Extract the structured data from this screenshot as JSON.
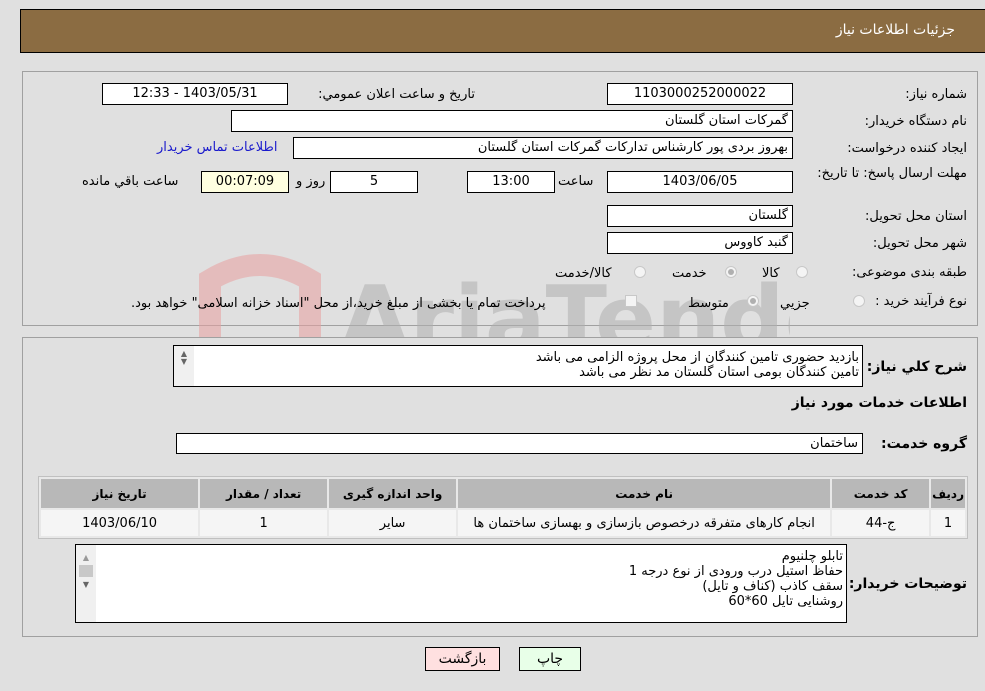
{
  "header": {
    "title": "جزئیات اطلاعات نیاز"
  },
  "details": {
    "need_number": {
      "label": "شماره نیاز:",
      "value": "1103000252000022"
    },
    "announce_datetime": {
      "label": "تاریخ و ساعت اعلان عمومي:",
      "value": "1403/05/31 - 12:33"
    },
    "buyer_org": {
      "label": "نام دستگاه خریدار:",
      "value": "گمرکات استان گلستان"
    },
    "requester": {
      "label": "ایجاد کننده درخواست:",
      "value": "بهروز بردی پور کارشناس تدارکات گمرکات استان گلستان"
    },
    "buyer_contact_link": "اطلاعات تماس خریدار",
    "deadline": {
      "label": "مهلت ارسال پاسخ: تا تاریخ:",
      "date": "1403/06/05",
      "time_label": "ساعت",
      "time": "13:00",
      "days": "5",
      "days_label": "روز و",
      "remaining": "00:07:09",
      "remaining_label": "ساعت باقي مانده"
    },
    "delivery_province": {
      "label": "استان محل تحویل:",
      "value": "گلستان"
    },
    "delivery_city": {
      "label": "شهر محل تحویل:",
      "value": "گنبد کاووس"
    },
    "category": {
      "label": "طبقه بندی موضوعی:",
      "options": [
        "کالا",
        "خدمت",
        "کالا/خدمت"
      ],
      "selected": "خدمت"
    },
    "process_type": {
      "label": "نوع فرآیند خرید :",
      "options": [
        "جزيي",
        "متوسط"
      ],
      "selected": "متوسط",
      "treasury_note": "پرداخت تمام یا بخشی از مبلغ خرید،از محل \"اسناد خزانه اسلامی\" خواهد بود."
    }
  },
  "description": {
    "label": "شرح كلي نياز:",
    "lines": [
      "بازدید حضوری تامین کنندگان از محل پروژه الزامی می باشد",
      "تامین کنندگان بومی استان گلستان مد نظر می باشد"
    ]
  },
  "services": {
    "section_title": "اطلاعات خدمات مورد نياز",
    "group_label": "گروه خدمت:",
    "group_value": "ساختمان",
    "table": {
      "headers": [
        "رديف",
        "کد خدمت",
        "نام خدمت",
        "واحد اندازه گیری",
        "تعداد / مقدار",
        "تاریخ نیاز"
      ],
      "rows": [
        [
          "1",
          "ج-44",
          "انجام کارهای متفرقه درخصوص بازسازی و بهسازی ساختمان ها",
          "سایر",
          "1",
          "1403/06/10"
        ]
      ]
    }
  },
  "buyer_notes": {
    "label": "توضیحات خریدار:",
    "lines": [
      "تابلو چلنیوم",
      "حفاظ استیل درب ورودی از نوع درجه 1",
      "سقف کاذب (کناف و تایل)",
      "روشنایی تایل 60*60"
    ]
  },
  "buttons": {
    "print": "چاپ",
    "back": "بازگشت"
  },
  "colors": {
    "header_bg": "#8b6c42",
    "back_bg": "#ffe0e0",
    "print_bg": "#e8ffe8",
    "link": "#1a1acc"
  }
}
